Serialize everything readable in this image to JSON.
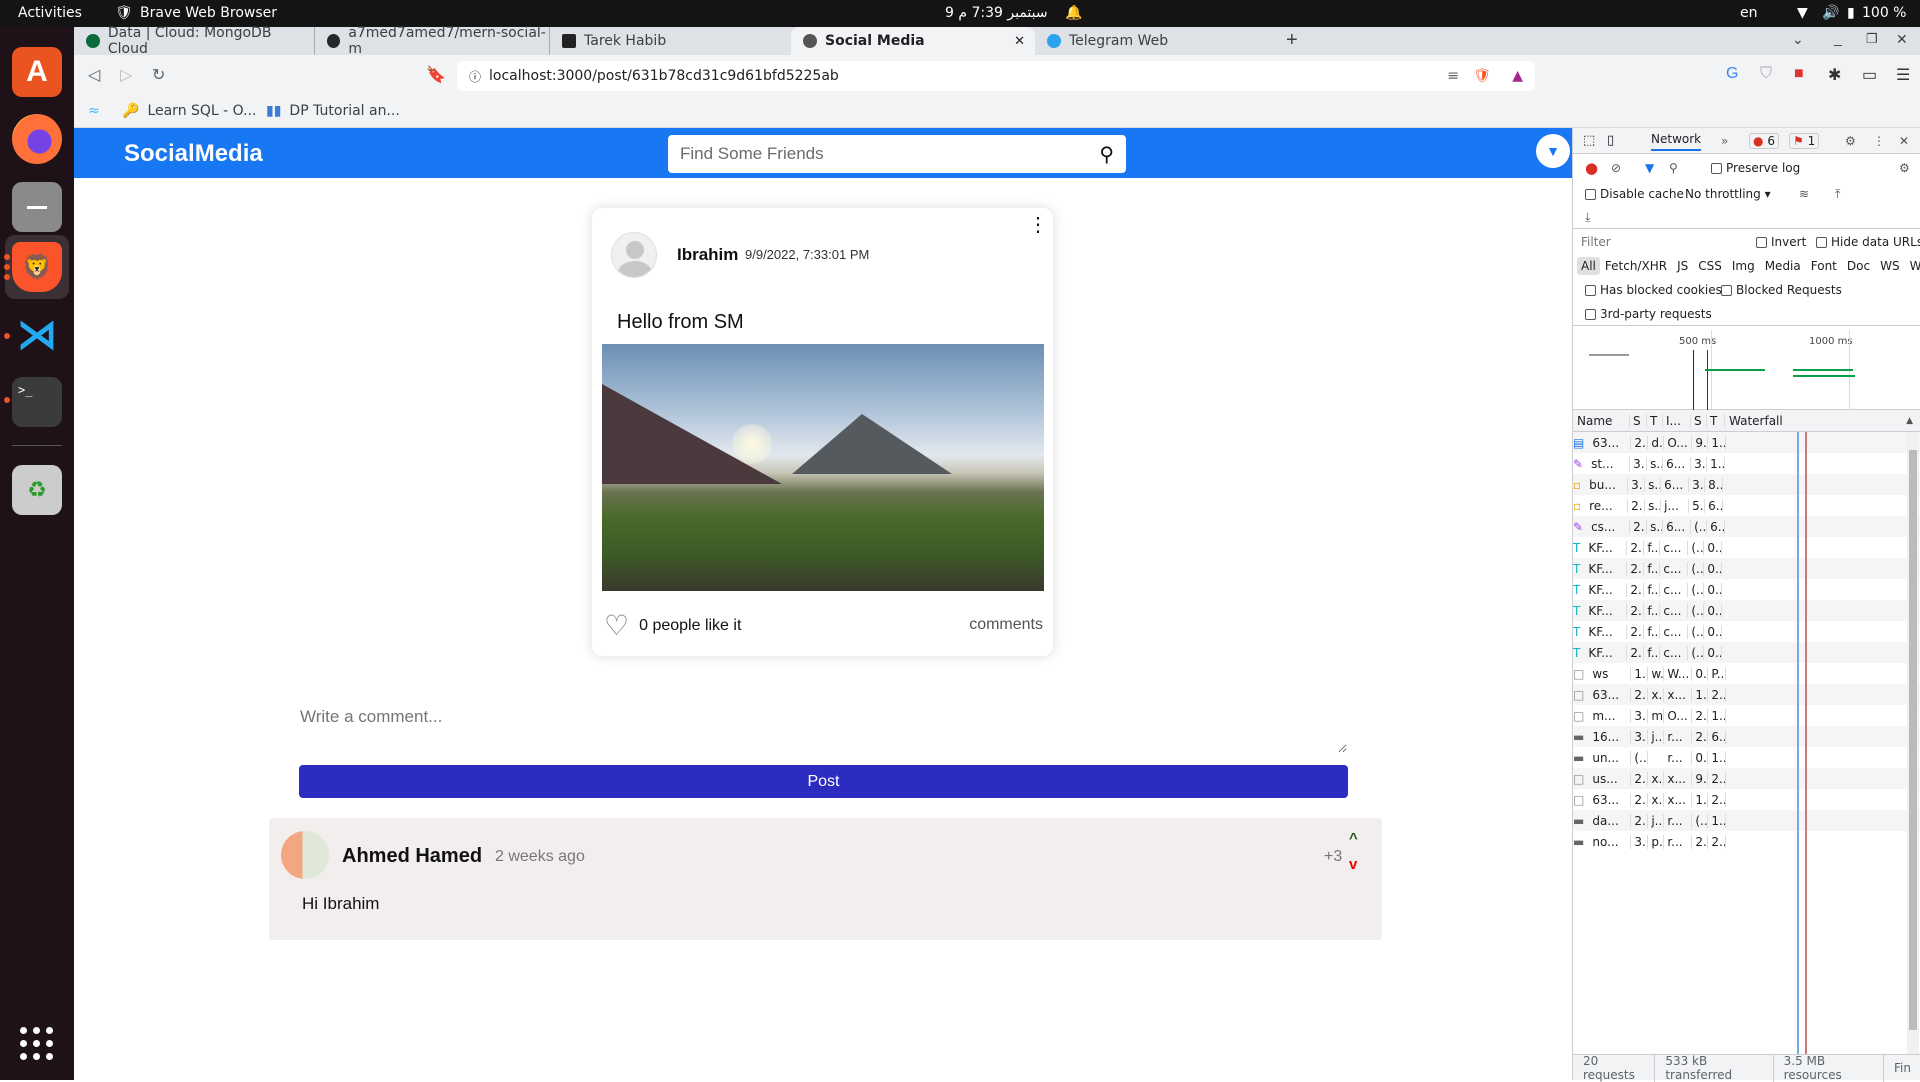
{
  "system_bar": {
    "activities": "Activities",
    "app_name": "Brave Web Browser",
    "clock": "9 سبتمبر  7:39 م",
    "language": "en",
    "battery": "100 %"
  },
  "dock": {
    "apps": [
      "Ubuntu Software",
      "Firefox",
      "Files",
      "Brave",
      "VS Code",
      "Terminal",
      "Trash"
    ]
  },
  "browser": {
    "tabs": [
      {
        "label": "Data | Cloud: MongoDB Cloud",
        "active": false
      },
      {
        "label": "a7med7amed7/mern-social-m",
        "active": false
      },
      {
        "label": "Tarek Habib",
        "active": false
      },
      {
        "label": "Social Media",
        "active": true
      },
      {
        "label": "Telegram Web",
        "active": false
      }
    ],
    "url": "localhost:3000/post/631b78cd31c9d61bfd5225ab",
    "bookmarks": [
      {
        "label": ""
      },
      {
        "label": "Learn SQL - O..."
      },
      {
        "label": "DP Tutorial an..."
      }
    ]
  },
  "app": {
    "logo": "SocialMedia",
    "search_placeholder": "Find Some Friends",
    "post": {
      "author": "Ibrahim",
      "date": "9/9/2022, 7:33:01 PM",
      "text": "Hello from SM",
      "likes_text": "0 people like it",
      "comments_label": "comments"
    },
    "comment_placeholder": "Write a comment...",
    "post_button": "Post",
    "comments": [
      {
        "author": "Ahmed Hamed",
        "time": "2 weeks ago",
        "text": "Hi Ibrahim",
        "score": "+3"
      }
    ]
  },
  "devtools": {
    "panel": "Network",
    "errors": "6",
    "warnings": "1",
    "preserve_log": "Preserve log",
    "disable_cache": "Disable cache",
    "throttling": "No throttling",
    "filter_placeholder": "Filter",
    "invert": "Invert",
    "hide_data_urls": "Hide data URLs",
    "types": [
      "All",
      "Fetch/XHR",
      "JS",
      "CSS",
      "Img",
      "Media",
      "Font",
      "Doc",
      "WS",
      "Was"
    ],
    "has_blocked_cookies": "Has blocked cookies",
    "blocked_requests": "Blocked Requests",
    "third_party": "3rd-party requests",
    "timeline_ticks": [
      "500 ms",
      "1000 ms"
    ],
    "columns": [
      "Name",
      "S",
      "T",
      "I...",
      "S",
      "T",
      "Waterfall"
    ],
    "rows": [
      {
        "icon": "doc",
        "cells": [
          "63...",
          "2.",
          "d.",
          "O...",
          "9.",
          "1.."
        ]
      },
      {
        "icon": "css",
        "cells": [
          "st...",
          "3.",
          "s..",
          "6...",
          "3.",
          "1.."
        ]
      },
      {
        "icon": "js",
        "cells": [
          "bu...",
          "3.",
          "s..",
          "6...",
          "3.",
          "8.."
        ]
      },
      {
        "icon": "js",
        "cells": [
          "re...",
          "2.",
          "s..",
          "j...",
          "5.",
          "6.."
        ]
      },
      {
        "icon": "css",
        "cells": [
          "cs...",
          "2.",
          "s..",
          "6...",
          "(..",
          "6.."
        ]
      },
      {
        "icon": "font",
        "cells": [
          "KF...",
          "2.",
          "f..",
          "c...",
          "(..",
          "0.."
        ]
      },
      {
        "icon": "font",
        "cells": [
          "KF...",
          "2.",
          "f..",
          "c...",
          "(..",
          "0.."
        ]
      },
      {
        "icon": "font",
        "cells": [
          "KF...",
          "2.",
          "f..",
          "c...",
          "(..",
          "0.."
        ]
      },
      {
        "icon": "font",
        "cells": [
          "KF...",
          "2.",
          "f..",
          "c...",
          "(..",
          "0.."
        ]
      },
      {
        "icon": "font",
        "cells": [
          "KF...",
          "2.",
          "f..",
          "c...",
          "(..",
          "0.."
        ]
      },
      {
        "icon": "font",
        "cells": [
          "KF...",
          "2.",
          "f..",
          "c...",
          "(..",
          "0.."
        ]
      },
      {
        "icon": "other",
        "cells": [
          "ws",
          "1.",
          "w.",
          "W...",
          "0.",
          "P.."
        ]
      },
      {
        "icon": "other",
        "cells": [
          "63...",
          "2.",
          "x.",
          "x...",
          "1.",
          "2.."
        ]
      },
      {
        "icon": "other",
        "cells": [
          "m...",
          "3.",
          "m",
          "O...",
          "2.",
          "1.."
        ]
      },
      {
        "icon": "img",
        "cells": [
          "16...",
          "3.",
          "j..",
          "r...",
          "2.",
          "6.."
        ]
      },
      {
        "icon": "img",
        "cells": [
          "un...",
          "(..",
          "",
          "r...",
          "0.",
          "1.."
        ]
      },
      {
        "icon": "other",
        "cells": [
          "us...",
          "2.",
          "x.",
          "x...",
          "9.",
          "2.."
        ]
      },
      {
        "icon": "other",
        "cells": [
          "63...",
          "2.",
          "x.",
          "x...",
          "1.",
          "2.."
        ]
      },
      {
        "icon": "img",
        "cells": [
          "da...",
          "2.",
          "j..",
          "r...",
          "(..",
          "1.."
        ]
      },
      {
        "icon": "img",
        "cells": [
          "no...",
          "3.",
          "p.",
          "r...",
          "2.",
          "2.."
        ]
      }
    ],
    "summary": {
      "requests": "20 requests",
      "transferred": "533 kB transferred",
      "resources": "3.5 MB resources",
      "finish": "Fin"
    }
  }
}
